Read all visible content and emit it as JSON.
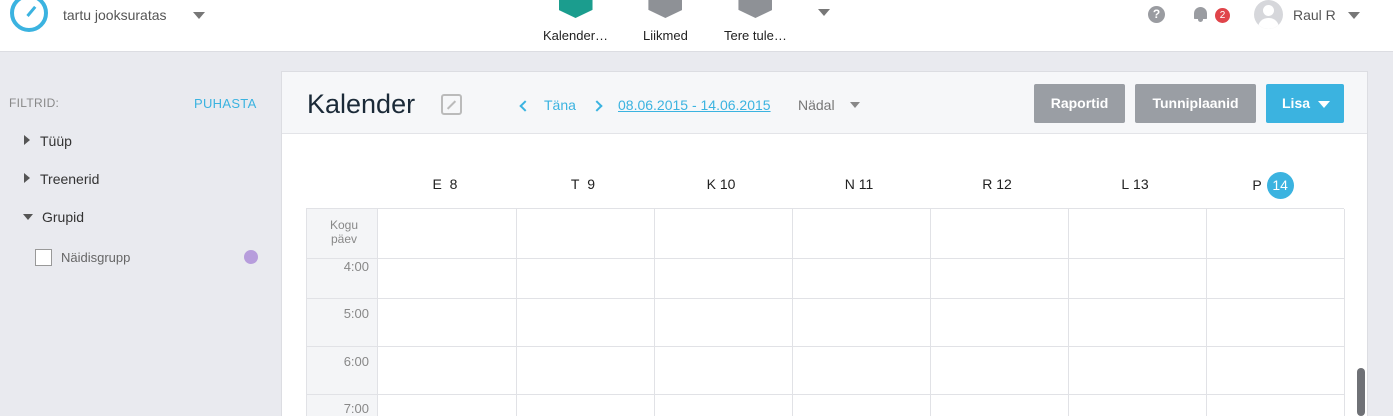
{
  "topbar": {
    "app_name": "tartu jooksuratas",
    "nav": [
      {
        "label": "Kalender…",
        "active": true
      },
      {
        "label": "Liikmed",
        "active": false
      },
      {
        "label": "Tere tule…",
        "active": false
      }
    ],
    "notification_count": "2",
    "user_name": "Raul R"
  },
  "sidebar": {
    "filters_label": "FILTRID:",
    "clear_label": "PUHASTA",
    "groups": [
      "Tüüp",
      "Treenerid",
      "Grupid"
    ],
    "group_item": {
      "label": "Näidisgrupp",
      "color": "#b79ddc"
    }
  },
  "calendar": {
    "title": "Kalender",
    "today_label": "Täna",
    "date_range": "08.06.2015 - 14.06.2015",
    "view": "Nädal",
    "buttons": {
      "reports": "Raportid",
      "schedules": "Tunniplaanid",
      "add": "Lisa"
    },
    "days": [
      {
        "letter": "E",
        "num": "8"
      },
      {
        "letter": "T",
        "num": "9"
      },
      {
        "letter": "K",
        "num": "10"
      },
      {
        "letter": "N",
        "num": "11"
      },
      {
        "letter": "R",
        "num": "12"
      },
      {
        "letter": "L",
        "num": "13"
      },
      {
        "letter": "P",
        "num": "14",
        "today": true
      }
    ],
    "allday_label": "Kogu päev",
    "hours": [
      "4:00",
      "5:00",
      "6:00",
      "7:00"
    ],
    "accent_color": "#3bb3e0"
  }
}
